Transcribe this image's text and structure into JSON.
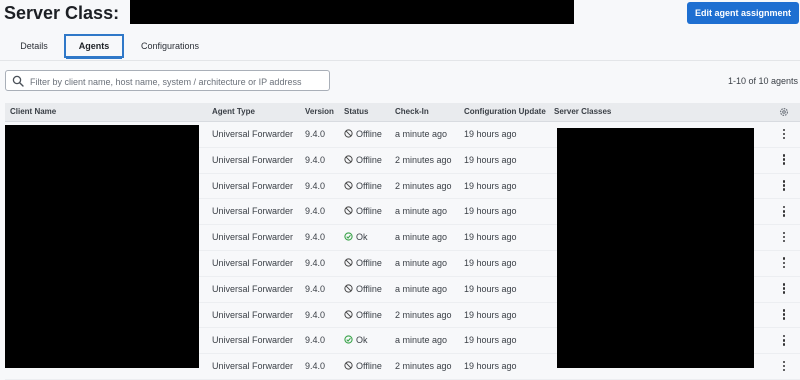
{
  "header": {
    "title": "Server Class:",
    "edit_button": "Edit agent assignment"
  },
  "tabs": [
    {
      "label": "Details"
    },
    {
      "label": "Agents"
    },
    {
      "label": "Configurations"
    }
  ],
  "search": {
    "placeholder": "Filter by client name, host name, system / architecture or IP address",
    "value": ""
  },
  "count_label": "1-10 of 10 agents",
  "table": {
    "columns": [
      "Client Name",
      "Agent Type",
      "Version",
      "Status",
      "Check-In",
      "Configuration Update",
      "Server Classes"
    ],
    "rows": [
      {
        "agent_type": "Universal Forwarder",
        "version": "9.4.0",
        "status": "Offline",
        "checkin": "a minute ago",
        "config_update": "19 hours ago"
      },
      {
        "agent_type": "Universal Forwarder",
        "version": "9.4.0",
        "status": "Offline",
        "checkin": "2 minutes ago",
        "config_update": "19 hours ago"
      },
      {
        "agent_type": "Universal Forwarder",
        "version": "9.4.0",
        "status": "Offline",
        "checkin": "2 minutes ago",
        "config_update": "19 hours ago"
      },
      {
        "agent_type": "Universal Forwarder",
        "version": "9.4.0",
        "status": "Offline",
        "checkin": "a minute ago",
        "config_update": "19 hours ago"
      },
      {
        "agent_type": "Universal Forwarder",
        "version": "9.4.0",
        "status": "Ok",
        "checkin": "a minute ago",
        "config_update": "19 hours ago"
      },
      {
        "agent_type": "Universal Forwarder",
        "version": "9.4.0",
        "status": "Offline",
        "checkin": "a minute ago",
        "config_update": "19 hours ago"
      },
      {
        "agent_type": "Universal Forwarder",
        "version": "9.4.0",
        "status": "Offline",
        "checkin": "a minute ago",
        "config_update": "19 hours ago"
      },
      {
        "agent_type": "Universal Forwarder",
        "version": "9.4.0",
        "status": "Offline",
        "checkin": "2 minutes ago",
        "config_update": "19 hours ago"
      },
      {
        "agent_type": "Universal Forwarder",
        "version": "9.4.0",
        "status": "Ok",
        "checkin": "a minute ago",
        "config_update": "19 hours ago"
      },
      {
        "agent_type": "Universal Forwarder",
        "version": "9.4.0",
        "status": "Offline",
        "checkin": "2 minutes ago",
        "config_update": "19 hours ago"
      }
    ]
  },
  "icons": {
    "search": "search-icon",
    "settings": "gear-icon",
    "offline": "offline-icon",
    "ok": "ok-check-icon",
    "row_menu": "kebab-menu-icon"
  },
  "colors": {
    "accent": "#1e6fd1",
    "tab_active": "#2f78c8",
    "ok": "#3aa34a",
    "offline": "#444444"
  }
}
